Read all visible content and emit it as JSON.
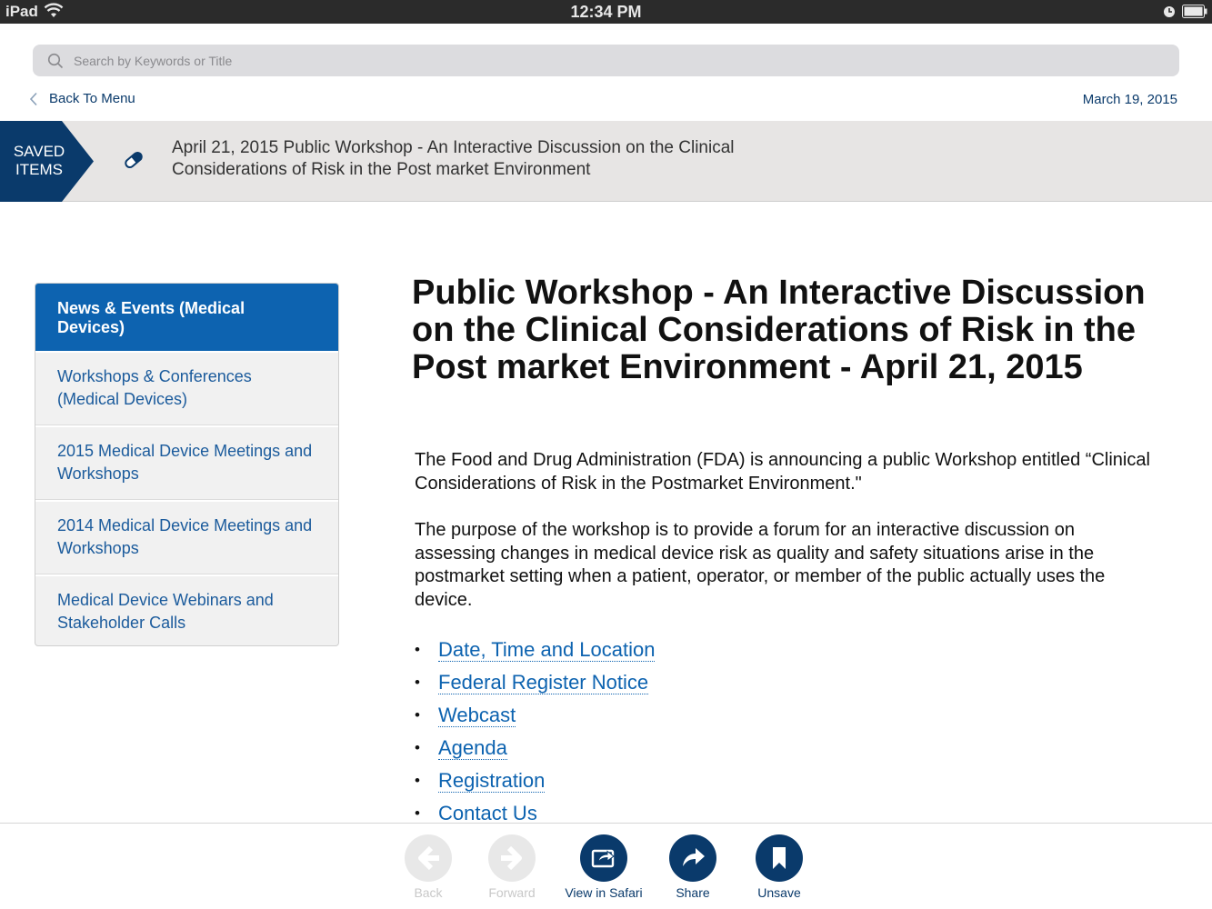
{
  "status_bar": {
    "device": "iPad",
    "time": "12:34 PM"
  },
  "search": {
    "placeholder": "Search by Keywords or Title"
  },
  "nav": {
    "back_label": "Back To Menu",
    "date": "March 19, 2015"
  },
  "saved_banner": {
    "tag_line1": "SAVED",
    "tag_line2": "ITEMS",
    "title": "April 21, 2015 Public Workshop - An Interactive Discussion on the Clinical Considerations of Risk in the Post market Environment"
  },
  "sidebar": {
    "header": "News & Events (Medical Devices)",
    "items": [
      {
        "label": "Workshops & Conferences (Medical Devices)"
      },
      {
        "label": "2015 Medical Device Meetings and Workshops"
      },
      {
        "label": "2014 Medical Device Meetings and Workshops"
      },
      {
        "label": "Medical Device Webinars and Stakeholder Calls"
      }
    ]
  },
  "article": {
    "title": "Public Workshop - An Interactive Discussion on the Clinical Considerations of Risk in the Post market Environment - April 21, 2015",
    "paragraphs": [
      "The Food and Drug Administration (FDA) is announcing a public Workshop entitled “Clinical Considerations of Risk in the Postmarket Environment.\"",
      "The purpose of the workshop is to provide a forum for an interactive discussion on assessing changes in medical device risk as quality and safety situations arise in the postmarket setting when a patient, operator, or member of the public actually uses the device."
    ],
    "links": [
      {
        "label": "Date, Time and Location"
      },
      {
        "label": "Federal Register Notice"
      },
      {
        "label": "Webcast"
      },
      {
        "label": "Agenda"
      },
      {
        "label": "Registration"
      },
      {
        "label": "Contact Us"
      }
    ]
  },
  "toolbar": {
    "back": "Back",
    "forward": "Forward",
    "safari": "View in Safari",
    "share": "Share",
    "unsave": "Unsave"
  },
  "colors": {
    "accent_navy": "#0a3a6b",
    "accent_blue": "#0d63b0",
    "banner_bg": "#e7e5e4"
  }
}
